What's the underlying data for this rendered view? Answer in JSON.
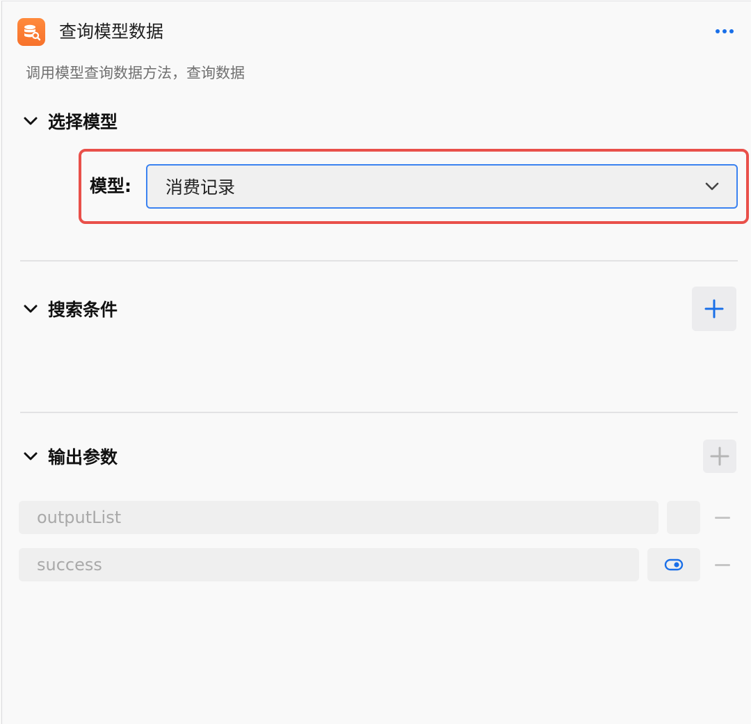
{
  "header": {
    "title": "查询模型数据",
    "subtitle": "调用模型查询数据方法，查询数据",
    "app_icon": "database-search-icon",
    "more_icon": "more-horizontal-icon"
  },
  "sections": {
    "select_model": {
      "title": "选择模型",
      "field_label": "模型:",
      "selected_value": "消费记录"
    },
    "search_conditions": {
      "title": "搜索条件"
    },
    "output_params": {
      "title": "输出参数",
      "rows": [
        {
          "name": "outputList",
          "type_icon": ""
        },
        {
          "name": "success",
          "type_icon": "toggle-icon"
        }
      ]
    }
  },
  "colors": {
    "accent": "#1a6fe8",
    "brand_orange": "#f7722b",
    "highlight": "#e9504a"
  }
}
